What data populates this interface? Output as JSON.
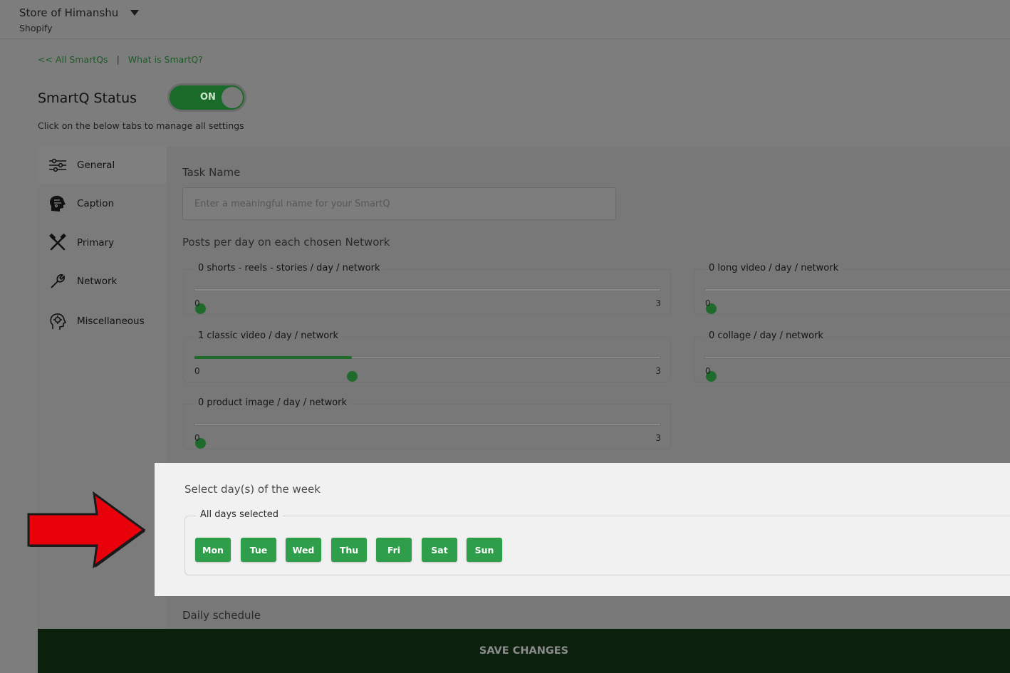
{
  "header": {
    "store_name": "Store of Himanshu",
    "platform": "Shopify"
  },
  "breadcrumbs": {
    "all_link": "<< All SmartQs",
    "separator": "|",
    "what_link": "What is SmartQ?"
  },
  "status": {
    "title": "SmartQ Status",
    "toggle_label": "ON",
    "toggle_on": true,
    "hint": "Click on the below tabs to manage all settings"
  },
  "sidebar": {
    "items": [
      {
        "label": "General",
        "icon": "sliders-icon"
      },
      {
        "label": "Caption",
        "icon": "head-circuit-icon"
      },
      {
        "label": "Primary",
        "icon": "crossed-tools-icon"
      },
      {
        "label": "Network",
        "icon": "wrench-icon"
      },
      {
        "label": "Miscellaneous",
        "icon": "gear-head-icon"
      }
    ]
  },
  "form": {
    "task_name_label": "Task Name",
    "task_name_placeholder": "Enter a meaningful name for your SmartQ",
    "task_name_value": "",
    "posts_label": "Posts per day on each chosen Network",
    "sliders": [
      {
        "label": "0 shorts - reels - stories / day / network",
        "value": 0,
        "min": 0,
        "max": 3,
        "min_label": "0",
        "max_label": "3"
      },
      {
        "label": "0 long video / day / network",
        "value": 0,
        "min": 0,
        "min_label": "0"
      },
      {
        "label": "1 classic video / day / network",
        "value": 1,
        "min": 0,
        "max": 3,
        "min_label": "0",
        "max_label": "3"
      },
      {
        "label": "0 collage / day / network",
        "value": 0,
        "min": 0,
        "min_label": "0"
      },
      {
        "label": "0 product image / day / network",
        "value": 0,
        "min": 0,
        "max": 3,
        "min_label": "0",
        "max_label": "3"
      }
    ],
    "days_title": "Select day(s) of the week",
    "days_legend": "All days selected",
    "days": [
      "Mon",
      "Tue",
      "Wed",
      "Thu",
      "Fri",
      "Sat",
      "Sun"
    ],
    "daily_schedule_label": "Daily schedule"
  },
  "footer": {
    "save_label": "SAVE CHANGES"
  },
  "colors": {
    "accent": "#2e9e4a",
    "toggle": "#1a6a29",
    "save_bar": "#0c200e",
    "arrow": "#e8000b"
  }
}
